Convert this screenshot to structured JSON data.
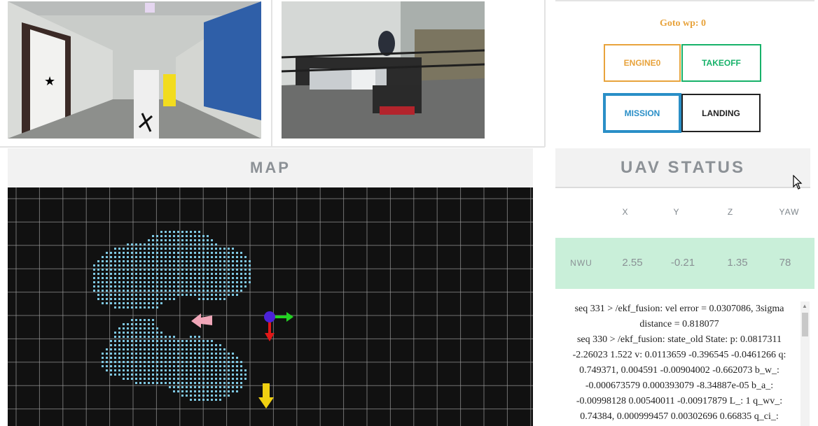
{
  "colors": {
    "goto_text": "#e8a33c",
    "engine": "#e8a33c",
    "takeoff": "#17b26a",
    "mission": "#2a8fc7",
    "landing": "#222222",
    "nwu_bg": "#c9efd9",
    "map_bg": "#111111",
    "point": "#7ec8e3"
  },
  "cameras": [
    {
      "name": "front-camera-feed",
      "icon": "hallway-image"
    },
    {
      "name": "external-camera-feed",
      "icon": "drone-image"
    }
  ],
  "control": {
    "goto": "Goto wp: 0",
    "engine_label": "ENGINE0",
    "takeoff_label": "TAKEOFF",
    "mission_label": "MISSION",
    "landing_label": "LANDING"
  },
  "map": {
    "title": "MAP",
    "markers": [
      "drone-pose-icon",
      "pink-arrow-icon",
      "yellow-arrow-icon"
    ]
  },
  "status": {
    "title": "UAV STATUS",
    "columns": [
      "X",
      "Y",
      "Z",
      "YAW"
    ],
    "rows": [
      {
        "frame": "NWU",
        "x": "2.55",
        "y": "-0.21",
        "z": "1.35",
        "yaw": "78"
      }
    ]
  },
  "log": [
    "seq 331 > /ekf_fusion: vel error = 0.0307086, 3sigma distance = 0.818077",
    "seq 330 > /ekf_fusion: state_old State: p: 0.0817311 -2.26023 1.522 v: 0.0113659 -0.396545 -0.0461266 q: 0.749371, 0.004591 -0.00904002 -0.662073 b_w_: -0.000673579 0.000393079 -8.34887e-05 b_a_: -0.00998128 0.00540011 -0.00917879 L_: 1 q_wv_: 0.74384, 0.000999457 0.00302696 0.66835 q_ci_:"
  ]
}
